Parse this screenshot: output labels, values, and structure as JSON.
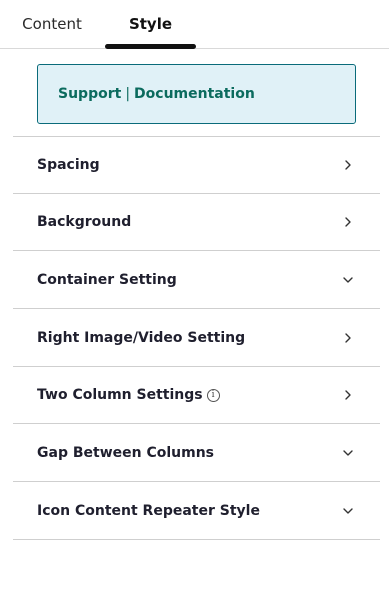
{
  "tabs": [
    {
      "label": "Content",
      "active": false
    },
    {
      "label": "Style",
      "active": true
    }
  ],
  "support": {
    "support_label": "Support",
    "separator": "|",
    "documentation_label": "Documentation"
  },
  "sections": [
    {
      "label": "Spacing",
      "icon": "chevron-right-icon"
    },
    {
      "label": "Background",
      "icon": "chevron-right-icon"
    },
    {
      "label": "Container Setting",
      "icon": "chevron-down-icon"
    },
    {
      "label": "Right Image/Video Setting",
      "icon": "chevron-right-icon"
    },
    {
      "label": "Two Column Settings",
      "icon": "chevron-right-icon",
      "info_icon": "info-icon"
    },
    {
      "label": "Gap Between Columns",
      "icon": "chevron-down-icon"
    },
    {
      "label": "Icon Content Repeater Style",
      "icon": "chevron-down-icon"
    }
  ],
  "colors": {
    "accent_text": "#0b6b5e",
    "support_bg": "#e0f1f7",
    "support_border": "#0a6b7a",
    "active_tab_underline": "#111111"
  }
}
